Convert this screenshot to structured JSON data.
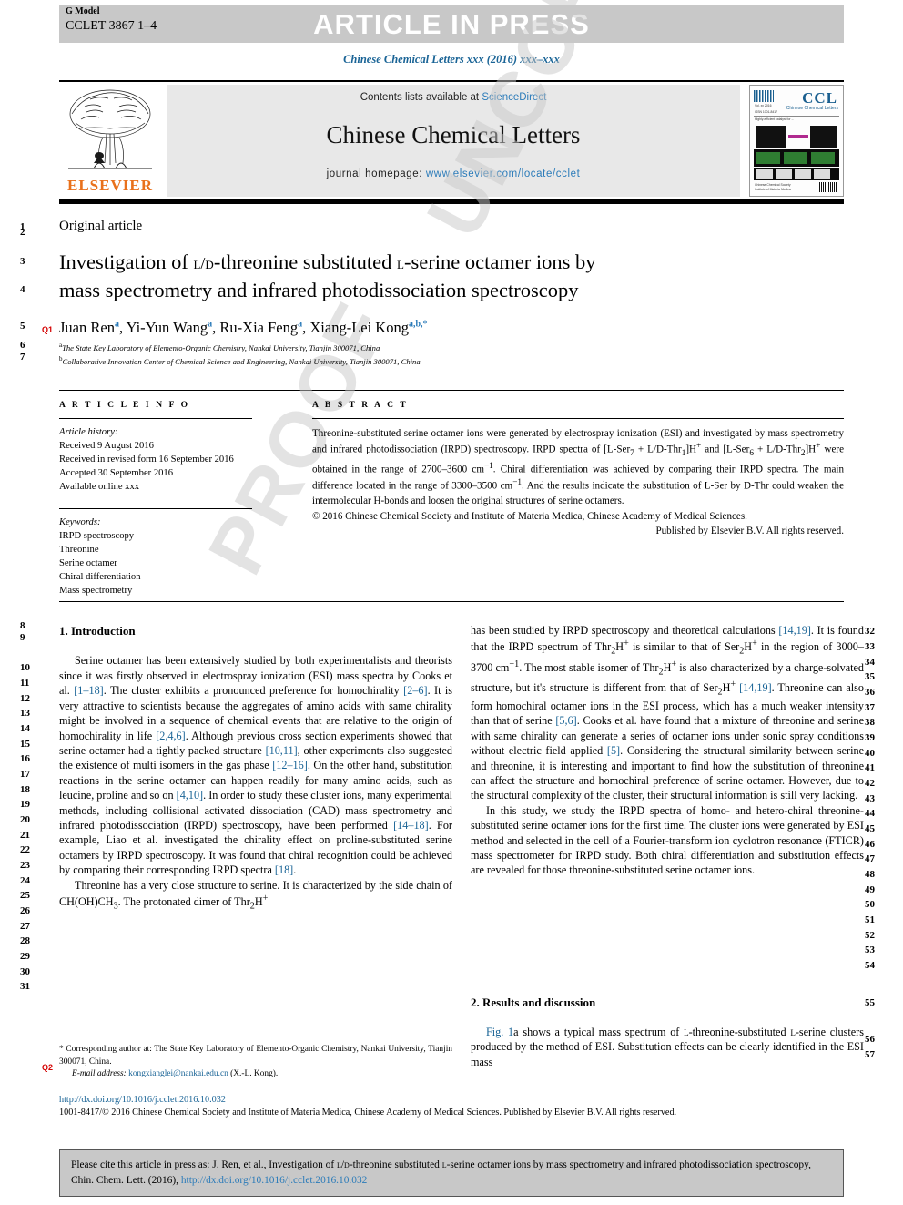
{
  "header": {
    "g_model_label": "G Model",
    "g_model_code": "CCLET 3867 1–4",
    "article_in_press": "ARTICLE IN PRESS",
    "journal_ref": "Chinese Chemical Letters xxx (2016) xxx–xxx"
  },
  "masthead": {
    "contents_prefix": "Contents lists available at ",
    "contents_link": "ScienceDirect",
    "journal_title": "Chinese Chemical Letters",
    "homepage_label": "journal homepage: ",
    "homepage_url": "www.elsevier.com/locate/cclet",
    "publisher": "ELSEVIER",
    "cover_title": "CCL",
    "cover_subtitle": "Chinese Chemical Letters"
  },
  "article": {
    "type": "Original article",
    "title_line1_a": "Investigation of ",
    "title_line1_sc1": "l/d",
    "title_line1_b": "-threonine substituted ",
    "title_line1_sc2": "l",
    "title_line1_c": "-serine octamer ions by",
    "title_line2": "mass spectrometry and infrared photodissociation spectroscopy",
    "query_tag_1": "Q1",
    "query_tag_2": "Q2",
    "authors_html": "Juan Ren, Yi-Yun Wang, Ru-Xia Feng, Xiang-Lei Kong",
    "authors": [
      {
        "name": "Juan Ren",
        "sup": "a"
      },
      {
        "name": "Yi-Yun Wang",
        "sup": "a"
      },
      {
        "name": "Ru-Xia Feng",
        "sup": "a"
      },
      {
        "name": "Xiang-Lei Kong",
        "sup": "a,b,*"
      }
    ],
    "affiliations": [
      {
        "sup": "a",
        "text": "The State Key Laboratory of Elemento-Organic Chemistry, Nankai University, Tianjin 300071, China"
      },
      {
        "sup": "b",
        "text": "Collaborative Innovation Center of Chemical Science and Engineering, Nankai University, Tianjin 300071, China"
      }
    ]
  },
  "article_info": {
    "label": "A R T I C L E   I N F O",
    "history_label": "Article history:",
    "history": [
      "Received 9 August 2016",
      "Received in revised form 16 September 2016",
      "Accepted 30 September 2016",
      "Available online xxx"
    ],
    "keywords_label": "Keywords:",
    "keywords": [
      "IRPD spectroscopy",
      "Threonine",
      "Serine octamer",
      "Chiral differentiation",
      "Mass spectrometry"
    ]
  },
  "abstract": {
    "label": "A B S T R A C T",
    "text": "Threonine-substituted serine octamer ions were generated by electrospray ionization (ESI) and investigated by mass spectrometry and infrared photodissociation (IRPD) spectroscopy. IRPD spectra of [L-Ser7 + L/D-Thr1]H+ and [L-Ser6 + L/D-Thr2]H+ were obtained in the range of 2700–3600 cm−1. Chiral differentiation was achieved by comparing their IRPD spectra. The main difference located in the range of 3300–3500 cm−1. And the results indicate the substitution of L-Ser by D-Thr could weaken the intermolecular H-bonds and loosen the original structures of serine octamers.",
    "copyright_line1": "© 2016 Chinese Chemical Society and Institute of Materia Medica, Chinese Academy of Medical Sciences.",
    "copyright_line2": "Published by Elsevier B.V. All rights reserved."
  },
  "body": {
    "section1_heading": "1. Introduction",
    "section2_heading": "2. Results and discussion",
    "left_paragraphs": [
      "Serine octamer has been extensively studied by both experimentalists and theorists since it was firstly observed in electrospray ionization (ESI) mass spectra by Cooks et al. [1–18]. The cluster exhibits a pronounced preference for homochirality [2–6]. It is very attractive to scientists because the aggregates of amino acids with same chirality might be involved in a sequence of chemical events that are relative to the origin of homochirality in life [2,4,6]. Although previous cross section experiments showed that serine octamer had a tightly packed structure [10,11], other experiments also suggested the existence of multi isomers in the gas phase [12–16]. On the other hand, substitution reactions in the serine octamer can happen readily for many amino acids, such as leucine, proline and so on [4,10]. In order to study these cluster ions, many experimental methods, including collisional activated dissociation (CAD) mass spectrometry and infrared photodissociation (IRPD) spectroscopy, have been performed [14–18]. For example, Liao et al. investigated the chirality effect on proline-substituted serine octamers by IRPD spectroscopy. It was found that chiral recognition could be achieved by comparing their corresponding IRPD spectra [18].",
      "Threonine has a very close structure to serine. It is characterized by the side chain of CH(OH)CH3. The protonated dimer of Thr2H+"
    ],
    "right_paragraphs": [
      "has been studied by IRPD spectroscopy and theoretical calculations [14,19]. It is found that the IRPD spectrum of Thr2H+ is similar to that of Ser2H+ in the region of 3000–3700 cm−1. The most stable isomer of Thr2H+ is also characterized by a charge-solvated structure, but it's structure is different from that of Ser2H+ [14,19]. Threonine can also form homochiral octamer ions in the ESI process, which has a much weaker intensity than that of serine [5,6]. Cooks et al. have found that a mixture of threonine and serine with same chirality can generate a series of octamer ions under sonic spray conditions without electric field applied [5]. Considering the structural similarity between serine and threonine, it is interesting and important to find how the substitution of threonine can affect the structure and homochiral preference of serine octamer. However, due to the structural complexity of the cluster, their structural information is still very lacking.",
      "In this study, we study the IRPD spectra of homo- and hetero-chiral threonine-substituted serine octamer ions for the first time. The cluster ions were generated by ESI method and selected in the cell of a Fourier-transform ion cyclotron resonance (FTICR) mass spectrometer for IRPD study. Both chiral differentiation and substitution effects are revealed for those threonine-substituted serine octamer ions."
    ],
    "section2_paragraph": "Fig. 1a shows a typical mass spectrum of l-threonine-substituted l-serine clusters produced by the method of ESI. Substitution effects can be clearly identified in the ESI mass"
  },
  "line_numbers": {
    "left": [
      "1",
      "2",
      "3",
      "4",
      "5",
      "6",
      "7",
      "8",
      "9",
      "10",
      "11",
      "12",
      "13",
      "14",
      "15",
      "16",
      "17",
      "18",
      "19",
      "20",
      "21",
      "22",
      "23",
      "24",
      "25",
      "26",
      "27",
      "28",
      "29",
      "30",
      "31"
    ],
    "right": [
      "32",
      "33",
      "34",
      "35",
      "36",
      "37",
      "38",
      "39",
      "40",
      "41",
      "42",
      "43",
      "44",
      "45",
      "46",
      "47",
      "48",
      "49",
      "50",
      "51",
      "52",
      "53",
      "54",
      "55",
      "56",
      "57"
    ]
  },
  "footnote": {
    "corresponding": "* Corresponding author at: The State Key Laboratory of Elemento-Organic Chemistry, Nankai University, Tianjin 300071, China.",
    "email_label": "E-mail address:",
    "email": "kongxianglei@nankai.edu.cn",
    "email_suffix": "(X.-L. Kong).",
    "doi": "http://dx.doi.org/10.1016/j.cclet.2016.10.032",
    "issn_line": "1001-8417/© 2016 Chinese Chemical Society and Institute of Materia Medica, Chinese Academy of Medical Sciences. Published by Elsevier B.V. All rights reserved."
  },
  "cite_box": {
    "text_part1": "Please cite this article in press as: J. Ren, et al., Investigation of l/d-threonine substituted l-serine octamer ions by mass spectrometry and infrared photodissociation spectroscopy, Chin. Chem. Lett. (2016), ",
    "link": "http://dx.doi.org/10.1016/j.cclet.2016.10.032"
  },
  "watermark": {
    "line1": "UNCORRECTED",
    "line2": "PROOF"
  },
  "colors": {
    "link": "#2b7bb9",
    "journal_blue": "#1a6496",
    "elsevier_orange": "#E9711C",
    "query_red": "#d40000",
    "gray_bar": "#c8c8c8"
  }
}
